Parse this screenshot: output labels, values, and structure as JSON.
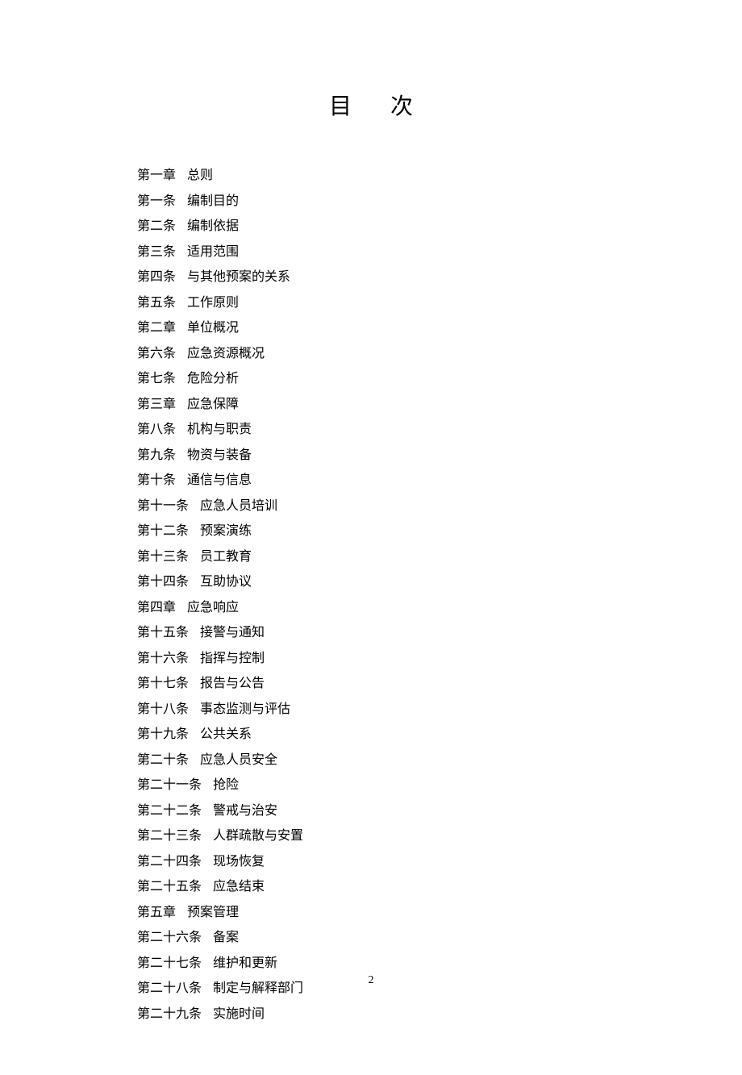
{
  "title": "目次",
  "pageNumber": "2",
  "toc": [
    {
      "label": "第一章",
      "text": "总则"
    },
    {
      "label": "第一条",
      "text": "编制目的"
    },
    {
      "label": "第二条",
      "text": "编制依据"
    },
    {
      "label": "第三条",
      "text": "适用范围"
    },
    {
      "label": "第四条",
      "text": "与其他预案的关系"
    },
    {
      "label": "第五条",
      "text": "工作原则"
    },
    {
      "label": "第二章",
      "text": "单位概况"
    },
    {
      "label": "第六条",
      "text": "应急资源概况"
    },
    {
      "label": "第七条",
      "text": "危险分析"
    },
    {
      "label": "第三章",
      "text": "应急保障"
    },
    {
      "label": "第八条",
      "text": "机构与职责"
    },
    {
      "label": "第九条",
      "text": "物资与装备"
    },
    {
      "label": "第十条",
      "text": "通信与信息"
    },
    {
      "label": "第十一条",
      "text": "应急人员培训"
    },
    {
      "label": "第十二条",
      "text": "预案演练"
    },
    {
      "label": "第十三条",
      "text": "员工教育"
    },
    {
      "label": "第十四条",
      "text": "互助协议"
    },
    {
      "label": "第四章",
      "text": "应急响应"
    },
    {
      "label": "第十五条",
      "text": "接警与通知"
    },
    {
      "label": "第十六条",
      "text": "指挥与控制"
    },
    {
      "label": "第十七条",
      "text": "报告与公告"
    },
    {
      "label": "第十八条",
      "text": "事态监测与评估"
    },
    {
      "label": "第十九条",
      "text": "公共关系"
    },
    {
      "label": "第二十条",
      "text": "应急人员安全"
    },
    {
      "label": "第二十一条",
      "text": "抢险"
    },
    {
      "label": "第二十二条",
      "text": "警戒与治安"
    },
    {
      "label": "第二十三条",
      "text": "人群疏散与安置"
    },
    {
      "label": "第二十四条",
      "text": "现场恢复"
    },
    {
      "label": "第二十五条",
      "text": "应急结束"
    },
    {
      "label": "第五章",
      "text": "预案管理"
    },
    {
      "label": "第二十六条",
      "text": "备案"
    },
    {
      "label": "第二十七条",
      "text": "维护和更新"
    },
    {
      "label": "第二十八条",
      "text": "制定与解释部门"
    },
    {
      "label": "第二十九条",
      "text": "实施时间"
    }
  ]
}
